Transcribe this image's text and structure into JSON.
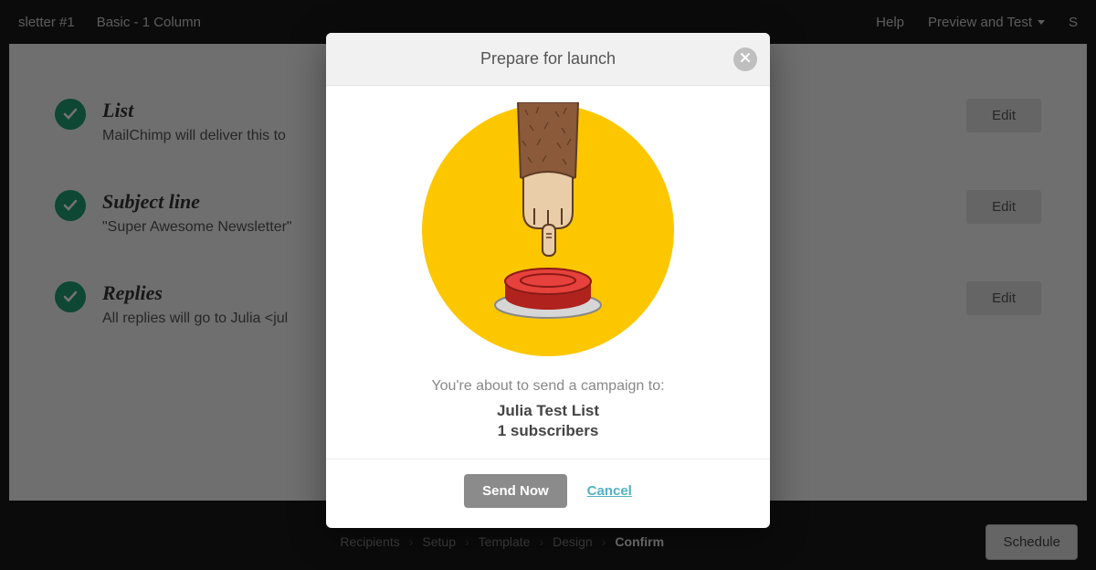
{
  "topnav": {
    "left": [
      "sletter #1",
      "Basic - 1 Column"
    ],
    "right": [
      "Help",
      "Preview and Test",
      "S"
    ]
  },
  "rows": [
    {
      "title": "List",
      "desc": "MailChimp will deliver this to",
      "edit": "Edit"
    },
    {
      "title": "Subject line",
      "desc": "\"Super Awesome Newsletter\"",
      "edit": "Edit"
    },
    {
      "title": "Replies",
      "desc": "All replies will go to Julia <jul",
      "edit": "Edit"
    }
  ],
  "footer": {
    "steps": [
      "Recipients",
      "Setup",
      "Template",
      "Design",
      "Confirm"
    ],
    "active_index": 4,
    "schedule": "Schedule"
  },
  "modal": {
    "title": "Prepare for launch",
    "lead": "You're about to send a campaign to:",
    "list": "Julia Test List",
    "count": "1 subscribers",
    "send": "Send Now",
    "cancel": "Cancel"
  },
  "colors": {
    "accent_teal": "#52b2c4",
    "check_green": "#1f9e73",
    "illus_yellow": "#fdc700",
    "button_red": "#d92f2b"
  }
}
